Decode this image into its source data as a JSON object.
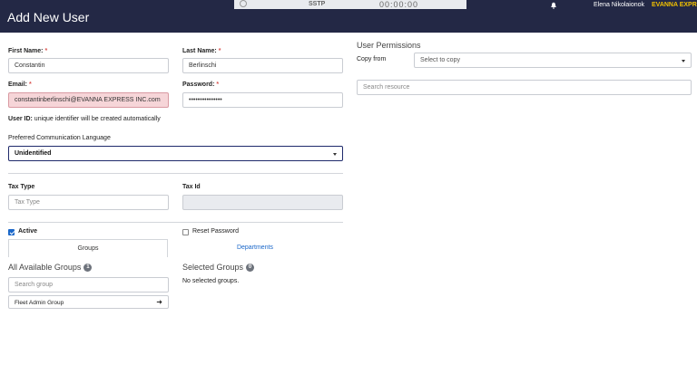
{
  "header": {
    "title": "Add New User",
    "user_name": "Elena Nikolaionok",
    "brand": "EVANNA EXPR"
  },
  "background_strip": {
    "text_a": "SSTP",
    "text_b": "00:00:00"
  },
  "form": {
    "first_name": {
      "label": "First Name:",
      "required": "*",
      "value": "Constantin"
    },
    "last_name": {
      "label": "Last Name:",
      "required": "*",
      "value": "Berlinschi"
    },
    "email": {
      "label": "Email:",
      "required": "*",
      "value": "constantinberlinschi@EVANNA EXPRESS INC.com"
    },
    "password": {
      "label": "Password:",
      "required": "*",
      "value": "•••••••••••••••"
    },
    "user_id_note": {
      "label": "User ID:",
      "text": "unique identifier will be created automatically"
    },
    "language": {
      "label": "Preferred Communication Language",
      "value": "Unidentified"
    },
    "tax_type": {
      "label": "Tax Type",
      "placeholder": "Tax Type"
    },
    "tax_id": {
      "label": "Tax Id",
      "value": ""
    },
    "active": {
      "label": "Active",
      "checked": true
    },
    "reset_password": {
      "label": "Reset Password",
      "checked": false
    }
  },
  "tabs": [
    {
      "label": "Groups",
      "active": true
    },
    {
      "label": "Departments",
      "active": false
    }
  ],
  "groups": {
    "available_title": "All Available Groups",
    "available_count": "1",
    "search_placeholder": "Search group",
    "items": [
      {
        "label": "Fleet Admin Group"
      }
    ],
    "selected_title": "Selected Groups",
    "selected_count": "0",
    "empty_text": "No selected groups."
  },
  "permissions": {
    "title": "User Permissions",
    "copy_from_label": "Copy from",
    "copy_from_value": "Select to copy",
    "search_placeholder": "Search resource"
  },
  "colors": {
    "header_bg": "#232845",
    "brand": "#f2c100",
    "link": "#1a67c9",
    "required": "#d9534f"
  }
}
